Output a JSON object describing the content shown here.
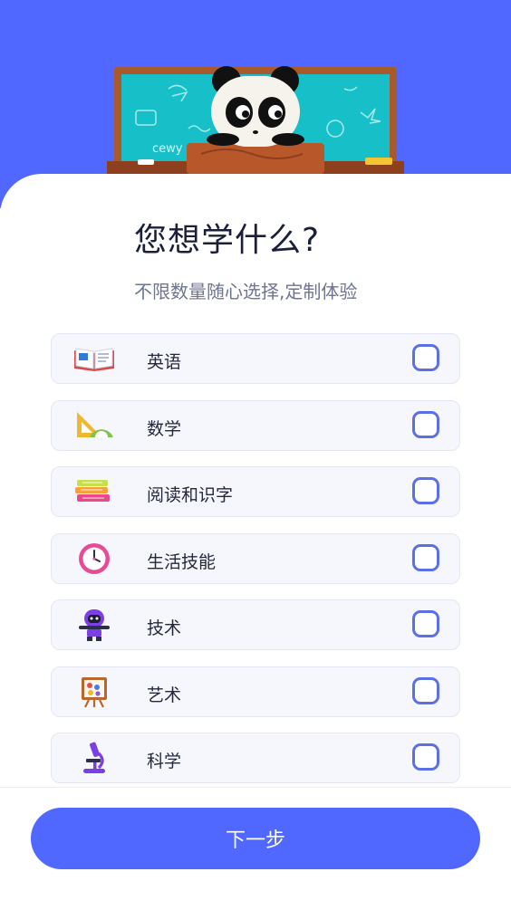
{
  "header": {
    "title": "您想学什么?",
    "subtitle": "不限数量随心选择,定制体验",
    "chalk_text": "cewy"
  },
  "options": [
    {
      "label": "英语",
      "icon": "open-book-icon",
      "checked": false
    },
    {
      "label": "数学",
      "icon": "ruler-protractor-icon",
      "checked": false
    },
    {
      "label": "阅读和识字",
      "icon": "books-stack-icon",
      "checked": false
    },
    {
      "label": "生活技能",
      "icon": "clock-icon",
      "checked": false
    },
    {
      "label": "技术",
      "icon": "robot-icon",
      "checked": false
    },
    {
      "label": "艺术",
      "icon": "easel-icon",
      "checked": false
    },
    {
      "label": "科学",
      "icon": "microscope-icon",
      "checked": false
    }
  ],
  "footer": {
    "next_label": "下一步"
  },
  "colors": {
    "primary": "#5068ff",
    "checkbox_border": "#5b6fe6",
    "card_bg": "#f6f7fd",
    "title": "#1a1f3a",
    "subtitle": "#6d7590"
  }
}
